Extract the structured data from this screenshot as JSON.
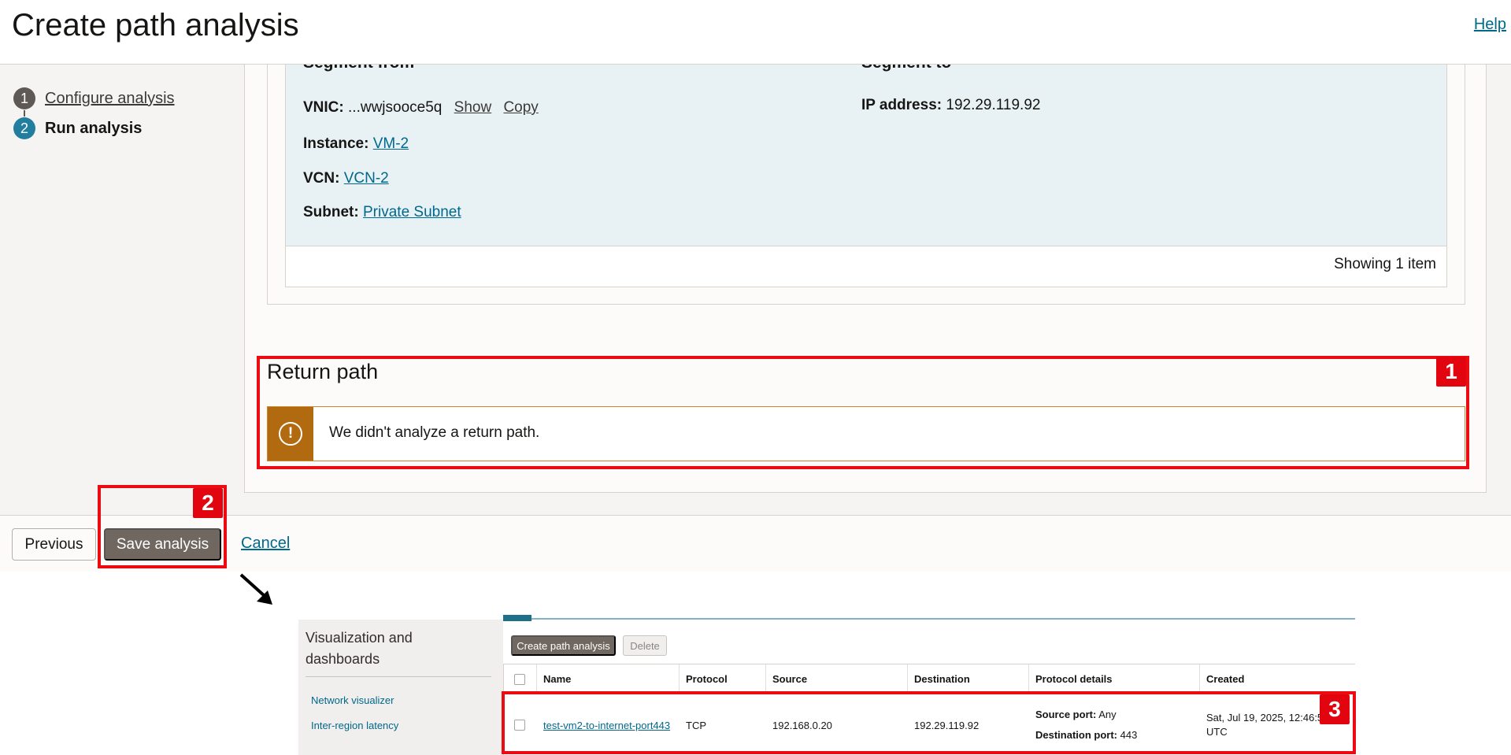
{
  "header": {
    "title": "Create path analysis",
    "help": "Help"
  },
  "steps": [
    {
      "num": "1",
      "label": "Configure analysis"
    },
    {
      "num": "2",
      "label": "Run analysis"
    }
  ],
  "segment": {
    "from_heading": "Segment from",
    "to_heading": "Segment to",
    "vnic_label": "VNIC:",
    "vnic_value": "...wwjsooce5q",
    "show": "Show",
    "copy": "Copy",
    "instance_label": "Instance:",
    "instance_value": "VM-2",
    "vcn_label": "VCN:",
    "vcn_value": "VCN-2",
    "subnet_label": "Subnet:",
    "subnet_value": "Private Subnet",
    "ip_label": "IP address:",
    "ip_value": "192.29.119.92",
    "showing": "Showing 1 item"
  },
  "return_path": {
    "title": "Return path",
    "message": "We didn't analyze a return path.",
    "icon": "exclamation-icon"
  },
  "footer": {
    "previous": "Previous",
    "save": "Save analysis",
    "cancel": "Cancel"
  },
  "thumbnail": {
    "sidebar_title": "Visualization and dashboards",
    "sidebar_links": [
      "Network visualizer",
      "Inter-region latency"
    ],
    "create_button": "Create path analysis",
    "delete_button": "Delete",
    "columns": [
      "Name",
      "Protocol",
      "Source",
      "Destination",
      "Protocol details",
      "Created"
    ],
    "row": {
      "name": "test-vm2-to-internet-port443",
      "protocol": "TCP",
      "source": "192.168.0.20",
      "destination": "192.29.119.92",
      "source_port_label": "Source port:",
      "source_port_value": "Any",
      "dest_port_label": "Destination port:",
      "dest_port_value": "443",
      "created_line1": "Sat, Jul 19, 2025, 12:46:51",
      "created_line2": "UTC"
    }
  },
  "annotations": {
    "badge1": "1",
    "badge2": "2",
    "badge3": "3",
    "color": "#ec0a13"
  }
}
